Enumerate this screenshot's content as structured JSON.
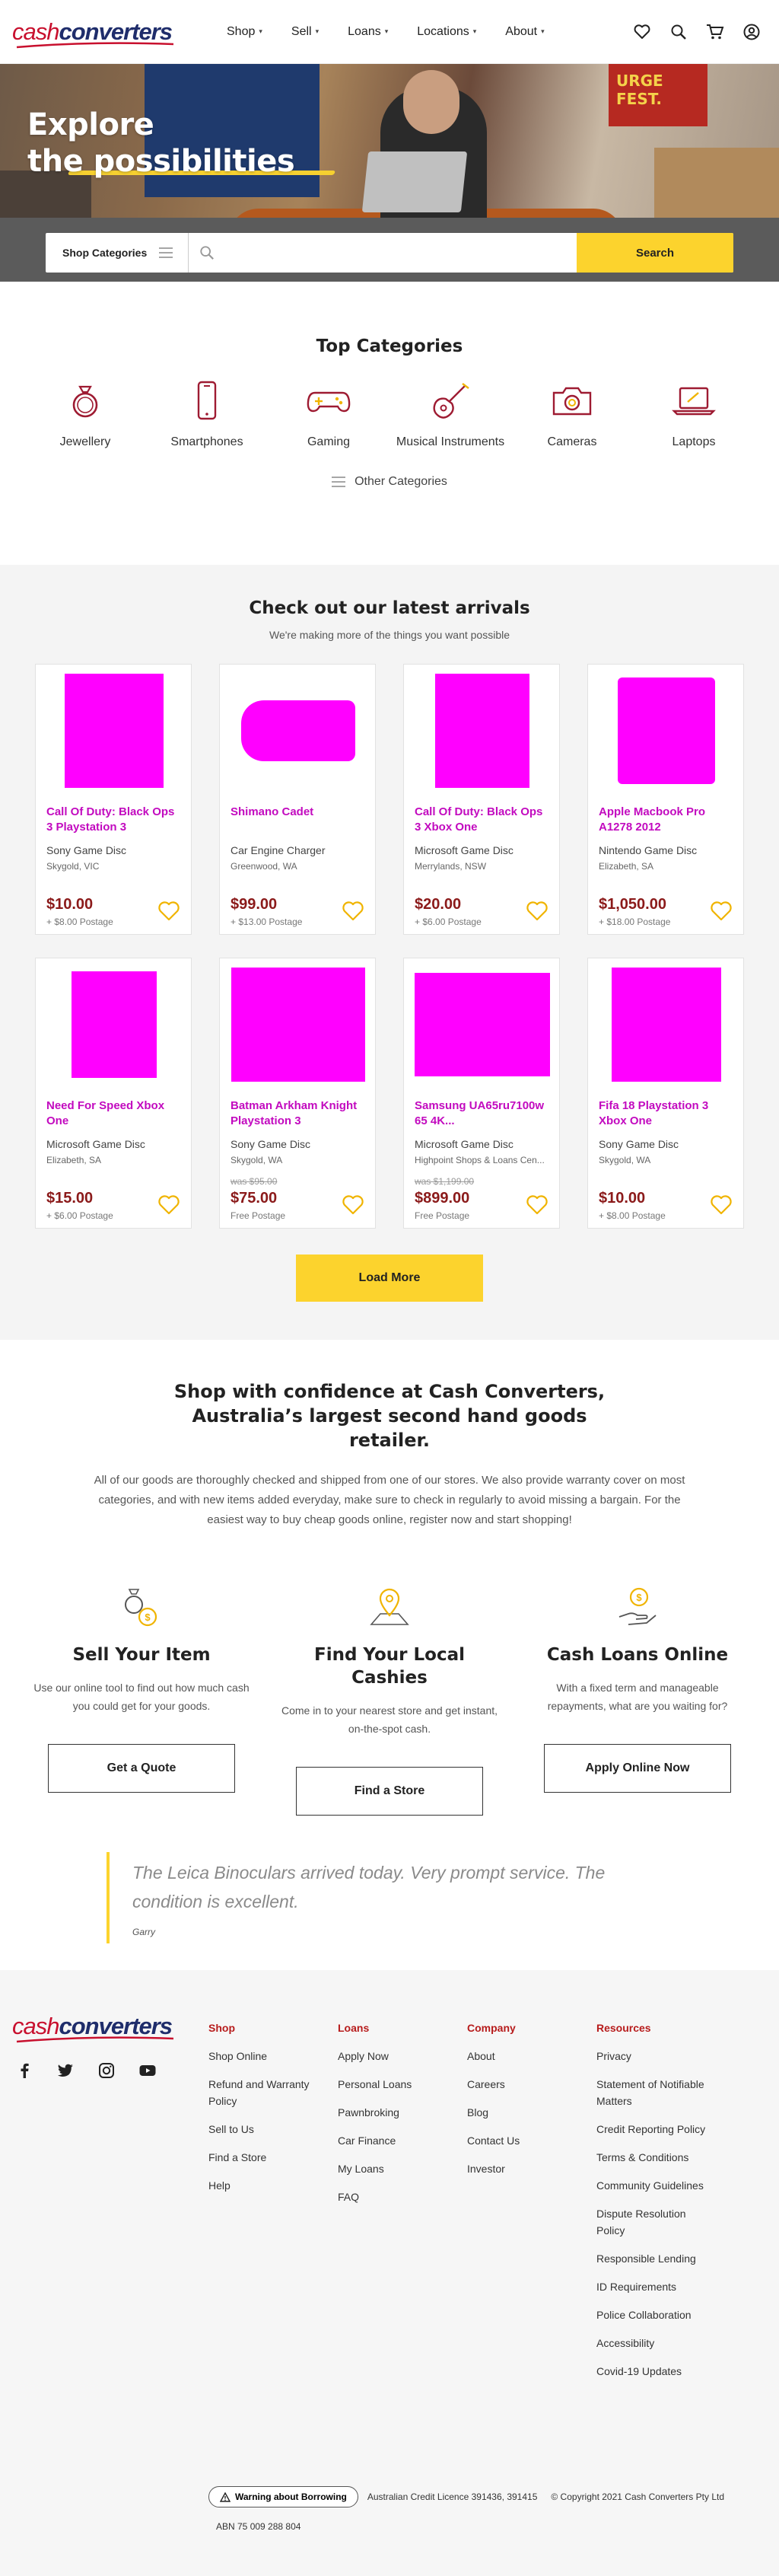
{
  "brand": {
    "logo_cash": "cash",
    "logo_converters": "converters",
    "accent": "#fcd32d",
    "brand_red": "#c8102e",
    "brand_navy": "#1f2d6b"
  },
  "nav": {
    "items": [
      {
        "label": "Shop",
        "icon": "chevron-down-icon"
      },
      {
        "label": "Sell",
        "icon": "chevron-down-icon"
      },
      {
        "label": "Loans",
        "icon": "chevron-down-icon"
      },
      {
        "label": "Locations",
        "icon": "chevron-down-icon"
      },
      {
        "label": "About",
        "icon": "chevron-down-icon"
      }
    ],
    "icons": [
      "heart-icon",
      "search-icon",
      "cart-icon",
      "user-icon"
    ]
  },
  "hero": {
    "line1": "Explore",
    "line2": "the possibilities",
    "poster_text": "URGE FEST."
  },
  "search": {
    "category_label": "Shop Categories",
    "placeholder": "",
    "button": "Search"
  },
  "top_categories": {
    "title": "Top Categories",
    "items": [
      {
        "label": "Jewellery",
        "icon": "ring-icon"
      },
      {
        "label": "Smartphones",
        "icon": "smartphone-icon"
      },
      {
        "label": "Gaming",
        "icon": "gamepad-icon"
      },
      {
        "label": "Musical Instruments",
        "icon": "guitar-icon"
      },
      {
        "label": "Cameras",
        "icon": "camera-icon"
      },
      {
        "label": "Laptops",
        "icon": "laptop-icon"
      }
    ],
    "other": "Other Categories"
  },
  "arrivals": {
    "title": "Check out our latest arrivals",
    "subtitle": "We're making more of the things you want possible",
    "products": [
      {
        "title": "Call Of Duty: Black Ops 3 Playstation 3",
        "sub": "Sony Game Disc",
        "loc": "Skygold, VIC",
        "was": "",
        "price": "$10.00",
        "postage": "+ $8.00 Postage"
      },
      {
        "title": "Shimano Cadet",
        "sub": "Car Engine Charger",
        "loc": "Greenwood, WA",
        "was": "",
        "price": "$99.00",
        "postage": "+ $13.00 Postage"
      },
      {
        "title": "Call Of Duty: Black Ops 3 Xbox One",
        "sub": "Microsoft Game Disc",
        "loc": "Merrylands, NSW",
        "was": "",
        "price": "$20.00",
        "postage": "+ $6.00 Postage"
      },
      {
        "title": "Apple Macbook Pro A1278 2012",
        "sub": "Nintendo Game Disc",
        "loc": "Elizabeth, SA",
        "was": "",
        "price": "$1,050.00",
        "postage": "+ $18.00 Postage"
      },
      {
        "title": "Need For Speed Xbox One",
        "sub": "Microsoft Game Disc",
        "loc": "Elizabeth, SA",
        "was": "",
        "price": "$15.00",
        "postage": "+ $6.00 Postage"
      },
      {
        "title": "Batman Arkham Knight Playstation 3",
        "sub": "Sony Game Disc",
        "loc": "Skygold, WA",
        "was": "was $95.00",
        "price": "$75.00",
        "postage": "Free Postage"
      },
      {
        "title": "Samsung UA65ru7100w 65 4K...",
        "sub": "Microsoft Game Disc",
        "loc": "Highpoint Shops & Loans Cen...",
        "was": "was $1,199.00",
        "price": "$899.00",
        "postage": "Free Postage"
      },
      {
        "title": "Fifa 18 Playstation 3 Xbox One",
        "sub": "Sony Game Disc",
        "loc": "Skygold, WA",
        "was": "",
        "price": "$10.00",
        "postage": "+ $8.00 Postage"
      }
    ],
    "load_more": "Load More"
  },
  "confidence": {
    "title": "Shop with confidence at Cash Converters, Australia’s largest second hand goods retailer.",
    "para": "All of our goods are thoroughly checked and shipped from one of our stores. We also provide warranty cover on most categories, and with new items added everyday, make sure to check in regularly to avoid missing a bargain. For the easiest way to buy cheap goods online, register now and start shopping!",
    "features": [
      {
        "title": "Sell Your Item",
        "text": "Use our online tool to find out how much cash you could get for your goods.",
        "button": "Get a Quote",
        "icon": "ring-coin-icon"
      },
      {
        "title": "Find Your Local Cashies",
        "text": "Come in to your nearest store and get instant, on-the-spot cash.",
        "button": "Find a Store",
        "icon": "map-pin-icon"
      },
      {
        "title": "Cash Loans Online",
        "text": "With a fixed term and manageable repayments, what are you waiting for?",
        "button": "Apply Online Now",
        "icon": "hand-coin-icon"
      }
    ],
    "quote": "The Leica Binoculars arrived today. Very prompt service. The condition is excellent.",
    "quote_author": "Garry"
  },
  "footer": {
    "socials": [
      "facebook-icon",
      "twitter-icon",
      "instagram-icon",
      "youtube-icon"
    ],
    "columns": [
      {
        "heading": "Shop",
        "links": [
          "Shop Online",
          "Refund and Warranty Policy",
          "Sell to Us",
          "Find a Store",
          "Help"
        ]
      },
      {
        "heading": "Loans",
        "links": [
          "Apply Now",
          "Personal Loans",
          "Pawnbroking",
          "Car Finance",
          "My Loans",
          "FAQ"
        ]
      },
      {
        "heading": "Company",
        "links": [
          "About",
          "Careers",
          "Blog",
          "Contact Us",
          "Investor"
        ]
      },
      {
        "heading": "Resources",
        "links": [
          "Privacy",
          "Statement of Notifiable Matters",
          "Credit Reporting Policy",
          "Terms & Conditions",
          "Community Guidelines",
          "Dispute Resolution Policy",
          "Responsible Lending",
          "ID Requirements",
          "Police Collaboration",
          "Accessibility",
          "Covid-19 Updates"
        ]
      }
    ],
    "warning_btn": "Warning about Borrowing",
    "licence": "Australian Credit Licence 391436, 391415",
    "copyright": "© Copyright 2021 Cash Converters Pty Ltd",
    "abn": "ABN 75 009 288 804"
  }
}
